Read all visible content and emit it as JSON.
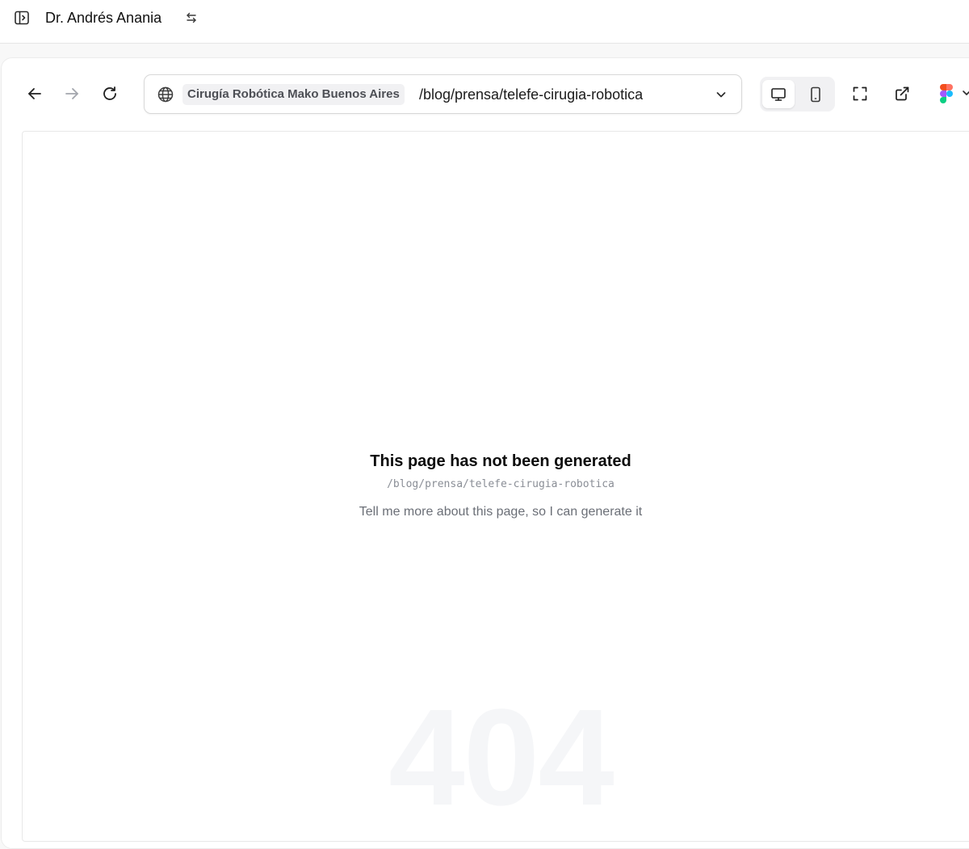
{
  "header": {
    "workspace_name": "Dr. Andrés Anania",
    "icons": {
      "sidebar_toggle": "sidebar-toggle-icon",
      "switch": "switch-arrows-icon"
    }
  },
  "browser": {
    "nav": {
      "back": "arrow-left-icon",
      "forward": "arrow-right-icon",
      "reload": "reload-icon"
    },
    "url": {
      "site_name": "Cirugía Robótica Mako Buenos Aires",
      "path": "/blog/prensa/telefe-cirugia-robotica",
      "icon": "globe-icon"
    },
    "device_mode": {
      "selected": "desktop",
      "options": [
        "desktop",
        "mobile"
      ]
    },
    "tools": [
      "fullscreen-icon",
      "external-link-icon",
      "figma-icon"
    ]
  },
  "preview": {
    "title": "This page has not been generated",
    "path": "/blog/prensa/telefe-cirugia-robotica",
    "hint": "Tell me more about this page, so I can generate it",
    "watermark": "404"
  },
  "colors": {
    "accent_text": "#111111",
    "muted_text": "#6b6f77",
    "chip_bg": "#f1f1f3",
    "watermark": "#f5f6f8"
  }
}
